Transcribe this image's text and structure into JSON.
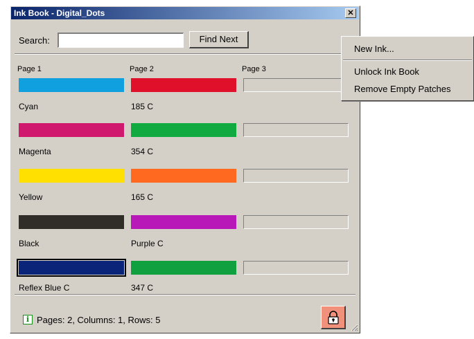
{
  "window": {
    "title": "Ink Book - Digital_Dots",
    "close_glyph": "✕"
  },
  "search": {
    "label": "Search:",
    "value": "",
    "placeholder": "",
    "find_button": "Find Next"
  },
  "pages": [
    "Page 1",
    "Page 2",
    "Page 3"
  ],
  "inks": [
    {
      "page1_name": "Cyan",
      "page1_color": "#10a0e0",
      "page2_name": "185 C",
      "page2_color": "#e0102a"
    },
    {
      "page1_name": "Magenta",
      "page1_color": "#d0186e",
      "page2_name": "354 C",
      "page2_color": "#10aa40"
    },
    {
      "page1_name": "Yellow",
      "page1_color": "#ffe000",
      "page2_name": "165 C",
      "page2_color": "#ff6a20"
    },
    {
      "page1_name": "Black",
      "page1_color": "#302c28",
      "page2_name": "Purple C",
      "page2_color": "#b818b8"
    },
    {
      "page1_name": "Reflex Blue C",
      "page1_color": "#0a247a",
      "page2_name": "347 C",
      "page2_color": "#10a040"
    }
  ],
  "status": {
    "text": "Pages: 2,  Columns: 1,  Rows: 5",
    "icon": "info-icon"
  },
  "lock": {
    "icon": "lock-icon"
  },
  "context_menu": {
    "items": [
      "New Ink...",
      "Unlock Ink Book",
      "Remove Empty Patches"
    ]
  }
}
